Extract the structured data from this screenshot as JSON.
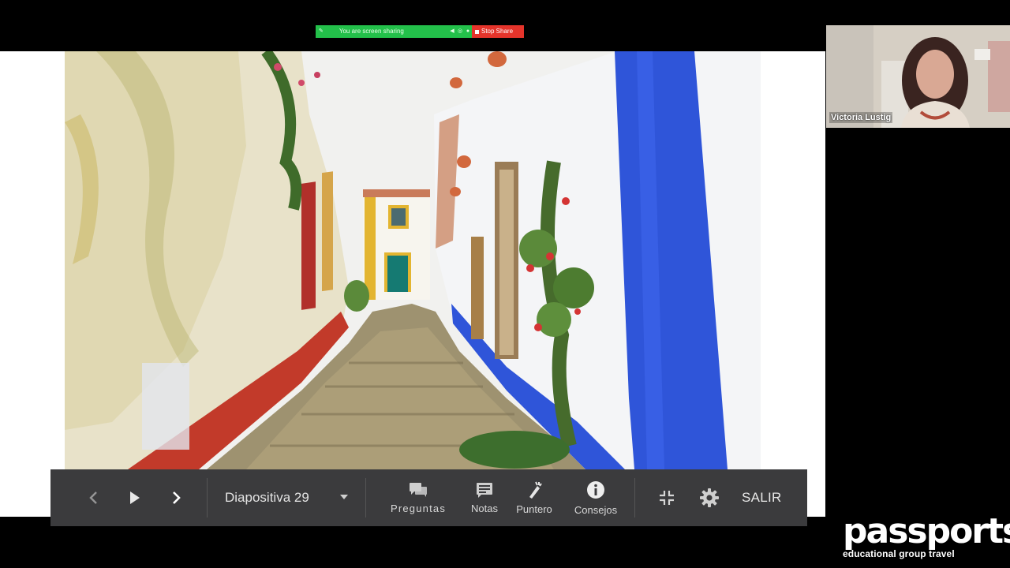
{
  "share_banner": {
    "status_text": "You are screen sharing",
    "stop_label": "Stop Share"
  },
  "slideshow": {
    "current_slide": "Diapositiva 29",
    "tools": {
      "preguntas": "Preguntas",
      "notas": "Notas",
      "puntero": "Puntero",
      "consejos": "Consejos"
    },
    "exit_label": "SALIR"
  },
  "video": {
    "participant_name": "Victoria Lustig"
  },
  "brand": {
    "name": "passports",
    "tagline": "educational group travel"
  },
  "colors": {
    "share_green": "#23c04a",
    "stop_red": "#e5342b",
    "control_bar": "#3b3b3d",
    "wall_blue": "#2f55d9"
  },
  "icons": {
    "prev": "chevron-left-icon",
    "play": "play-icon",
    "next": "chevron-right-icon",
    "preguntas": "chat-bubbles-icon",
    "notas": "notes-icon",
    "puntero": "laser-pointer-icon",
    "consejos": "info-icon",
    "minimize": "exit-fullscreen-icon",
    "settings": "gear-icon"
  }
}
